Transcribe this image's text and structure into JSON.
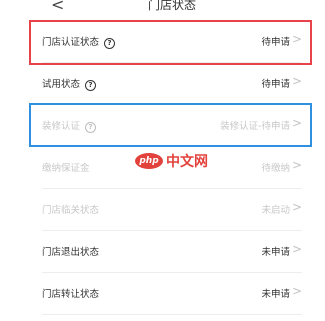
{
  "nav": {
    "back_glyph": "<",
    "title": "门店状态"
  },
  "rows": [
    {
      "label": "门店认证状态",
      "value": "待申请",
      "help": "?",
      "muted": false
    },
    {
      "label": "试用状态",
      "value": "待申请",
      "help": "?",
      "muted": false
    },
    {
      "label": "装修认证",
      "value": "装修认证-待申请",
      "help": "?",
      "muted": true
    },
    {
      "label": "缴纳保证金",
      "value": "待缴纳",
      "muted": true
    },
    {
      "label": "门店临关状态",
      "value": "未启动",
      "muted": true
    },
    {
      "label": "门店退出状态",
      "value": "未申请",
      "muted": false
    },
    {
      "label": "门店转让状态",
      "value": "未申请",
      "muted": false
    }
  ],
  "chevron_glyph": ">",
  "watermark": {
    "logo": "php",
    "text": "中文网"
  },
  "colors": {
    "highlight_red": "#e8424b",
    "highlight_blue": "#2f8fe0",
    "watermark_red": "#e0322b"
  }
}
